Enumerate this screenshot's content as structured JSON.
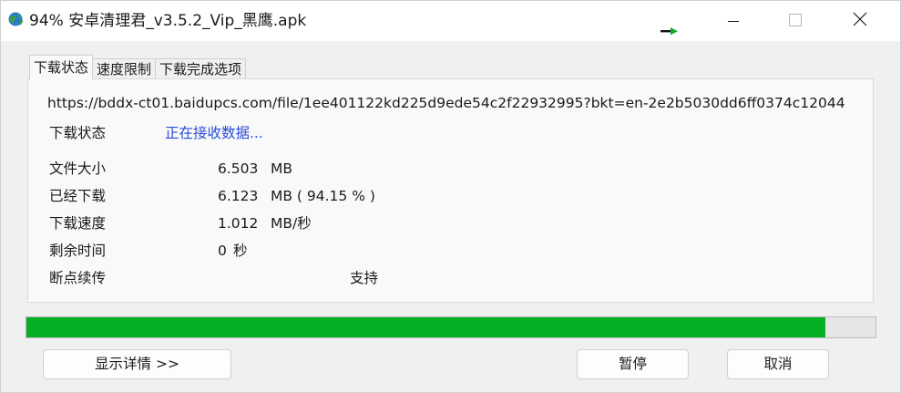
{
  "window": {
    "title": "94% 安卓清理君_v3.5.2_Vip_黑鹰.apk",
    "icons": {
      "app": "globe-download-icon",
      "tray": "green-arrow-icon",
      "minimize": "minimize-icon",
      "maximize": "maximize-icon",
      "close": "close-icon"
    }
  },
  "tabs": [
    {
      "label": "下载状态",
      "active": true
    },
    {
      "label": "速度限制",
      "active": false
    },
    {
      "label": "下载完成选项",
      "active": false
    }
  ],
  "download": {
    "url": "https://bddx-ct01.baidupcs.com/file/1ee401122kd225d9ede54c2f22932995?bkt=en-2e2b5030dd6ff0374c12044",
    "status_label": "下载状态",
    "status_value": "正在接收数据...",
    "size_label": "文件大小",
    "size_value": "6.503",
    "size_unit": "MB",
    "downloaded_label": "已经下载",
    "downloaded_value": "6.123",
    "downloaded_unit": "MB ( 94.15 % )",
    "speed_label": "下载速度",
    "speed_value": "1.012",
    "speed_unit": "MB/秒",
    "remaining_label": "剩余时间",
    "remaining_value": "0",
    "remaining_unit": "秒",
    "resume_label": "断点续传",
    "resume_value": "支持"
  },
  "progress": {
    "percent": 94.15,
    "color": "#06b025"
  },
  "buttons": {
    "details": "显示详情 >>",
    "pause": "暂停",
    "cancel": "取消"
  }
}
